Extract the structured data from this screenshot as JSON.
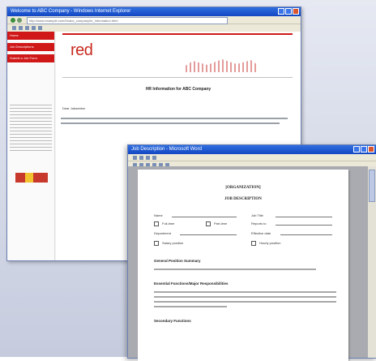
{
  "window1": {
    "title": "Welcome to ABC Company - Windows Internet Explorer",
    "address": "http://www.example.com/hr/abc_company/hr_information.html",
    "sidebar": [
      "Home",
      "Job Descriptions",
      "Submit a Job Form"
    ],
    "logo": "red",
    "heading": "HR Information for ABC Company",
    "salutation": "Dear Jobseeker"
  },
  "window2": {
    "title": "Job Description - Microsoft Word",
    "doc": {
      "org": "[ORGANIZATION]",
      "title": "JOB DESCRIPTION",
      "labels": [
        "Name",
        "Job Title",
        "Full-time",
        "Part-time",
        "Reports to",
        "Department",
        "Effective date",
        "Salary position",
        "Hourly position"
      ],
      "section1": "General Position Summary",
      "section2": "Essential Functions/Major Responsibilities",
      "section3": "Secondary Functions"
    }
  },
  "colors": {
    "brand_red": "#d01818",
    "titlebar_blue": "#1f5fd8"
  }
}
